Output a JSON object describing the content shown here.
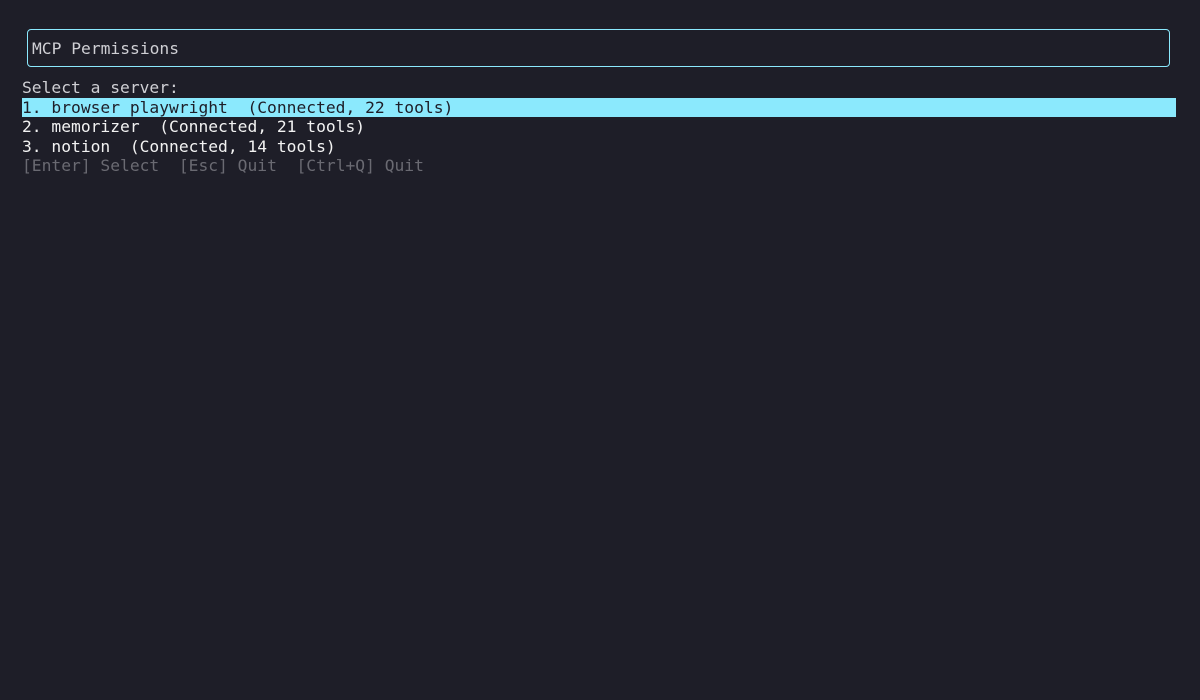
{
  "header": {
    "title": "MCP Permissions"
  },
  "prompt": "Select a server:",
  "servers": [
    {
      "label": "1. browser playwright  (Connected, 22 tools)",
      "selected": true
    },
    {
      "label": "2. memorizer  (Connected, 21 tools)",
      "selected": false
    },
    {
      "label": "3. notion  (Connected, 14 tools)",
      "selected": false
    }
  ],
  "hints": {
    "enter": "[Enter] Select",
    "esc": "[Esc] Quit",
    "ctrlq": "[Ctrl+Q] Quit"
  },
  "colors": {
    "background": "#1e1e28",
    "accent": "#8be9fd",
    "hint": "#6a6a72"
  }
}
